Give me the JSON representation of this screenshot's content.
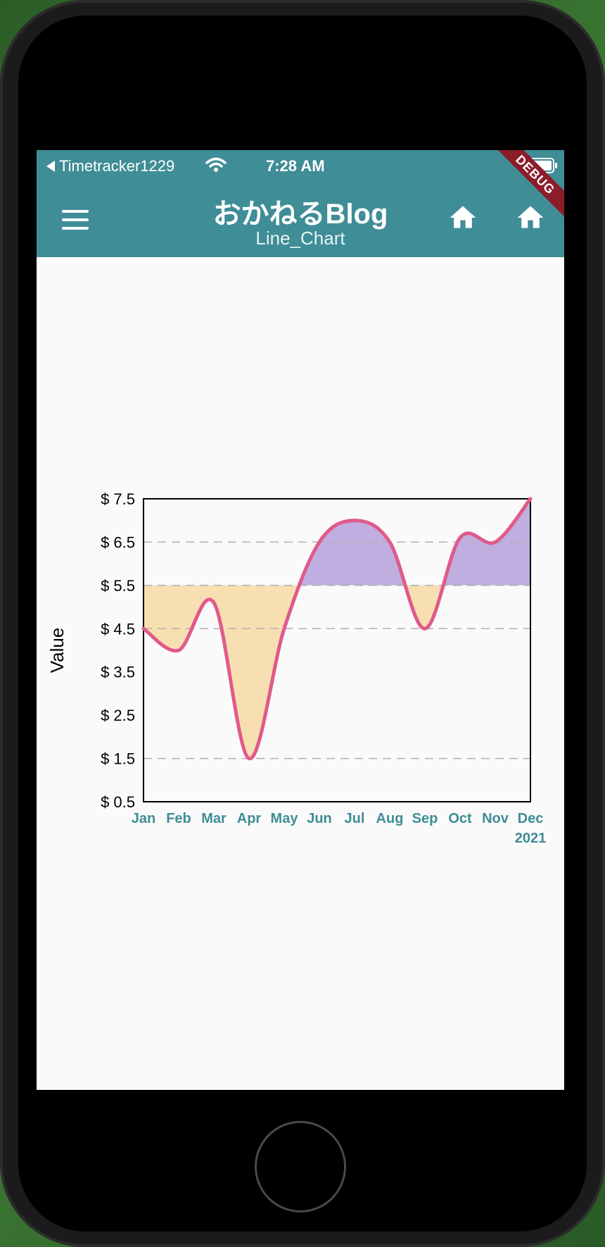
{
  "status_bar": {
    "carrier": "Timetracker1229",
    "time": "7:28 AM"
  },
  "app_bar": {
    "title": "おかねるBlog",
    "subtitle": "Line_Chart",
    "debug_label": "DEBUG",
    "color": "#3f8d96"
  },
  "icons": [
    "menu-icon",
    "home-icon",
    "home-icon"
  ],
  "chart_data": {
    "type": "area",
    "categories": [
      "Jan",
      "Feb",
      "Mar",
      "Apr",
      "May",
      "Jun",
      "Jul",
      "Aug",
      "Sep",
      "Oct",
      "Nov",
      "Dec"
    ],
    "x_group_label": "2021",
    "series": [
      {
        "values": [
          4.5,
          4.0,
          5.1,
          1.5,
          4.5,
          6.5,
          7.0,
          6.5,
          4.5,
          6.6,
          6.5,
          7.5
        ],
        "color": "#e05a8a"
      }
    ],
    "baseline": 5.5,
    "fill_above_color": "#c0aee0",
    "fill_below_color": "#f8dfb2",
    "ylabel": "Value",
    "ylim": [
      0.5,
      7.5
    ],
    "y_ticks": [
      0.5,
      1.5,
      2.5,
      3.5,
      4.5,
      5.5,
      6.5,
      7.5
    ],
    "y_tick_labels": [
      "$ 0.5",
      "$ 1.5",
      "$ 2.5",
      "$ 3.5",
      "$ 4.5",
      "$ 5.5",
      "$ 6.5",
      "$ 7.5"
    ],
    "dashed_gridlines_at": [
      1.5,
      4.5,
      5.5,
      6.5
    ],
    "x_label_color": "#3f8d96"
  }
}
